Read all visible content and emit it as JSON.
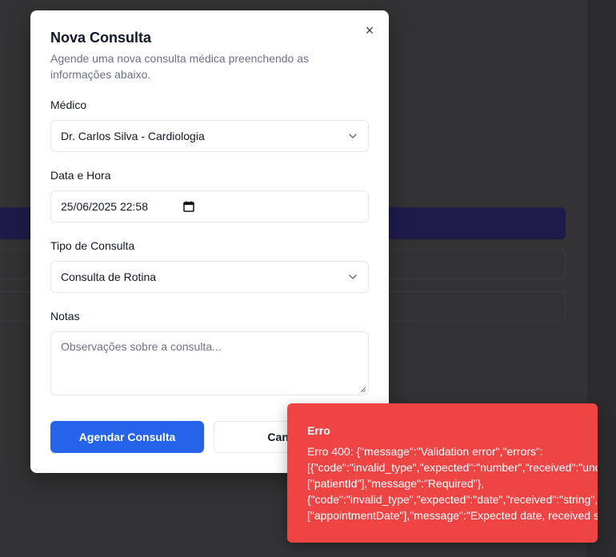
{
  "modal": {
    "title": "Nova Consulta",
    "description": "Agende uma nova consulta médica preenchendo as informações abaixo.",
    "close_symbol": "×",
    "fields": {
      "doctor": {
        "label": "Médico",
        "value": "Dr. Carlos Silva - Cardiologia"
      },
      "datetime": {
        "label": "Data e Hora",
        "value": "25/06/2025 22:58"
      },
      "type": {
        "label": "Tipo de Consulta",
        "value": "Consulta de Rotina"
      },
      "notes": {
        "label": "Notas",
        "placeholder": "Observações sobre a consulta..."
      }
    },
    "buttons": {
      "submit": "Agendar Consulta",
      "cancel": "Cancelar"
    }
  },
  "toast": {
    "title": "Erro",
    "lines": [
      "Erro 400: {\"message\":\"Validation error\",\"errors\":",
      "[{\"code\":\"invalid_type\",\"expected\":\"number\",\"received\":\"undefined\",\"path\":",
      "[\"patientId\"],\"message\":\"Required\"},",
      "{\"code\":\"invalid_type\",\"expected\":\"date\",\"received\":\"string\",\"path\":",
      "[\"appointmentDate\"],\"message\":\"Expected date, received string\"}]}"
    ]
  },
  "colors": {
    "primary": "#2563eb",
    "error": "#ef4444",
    "backdrop": "#333335"
  },
  "icons": {
    "close": "close-icon",
    "select": "chevron-down-icon",
    "calendar": "calendar-icon"
  }
}
